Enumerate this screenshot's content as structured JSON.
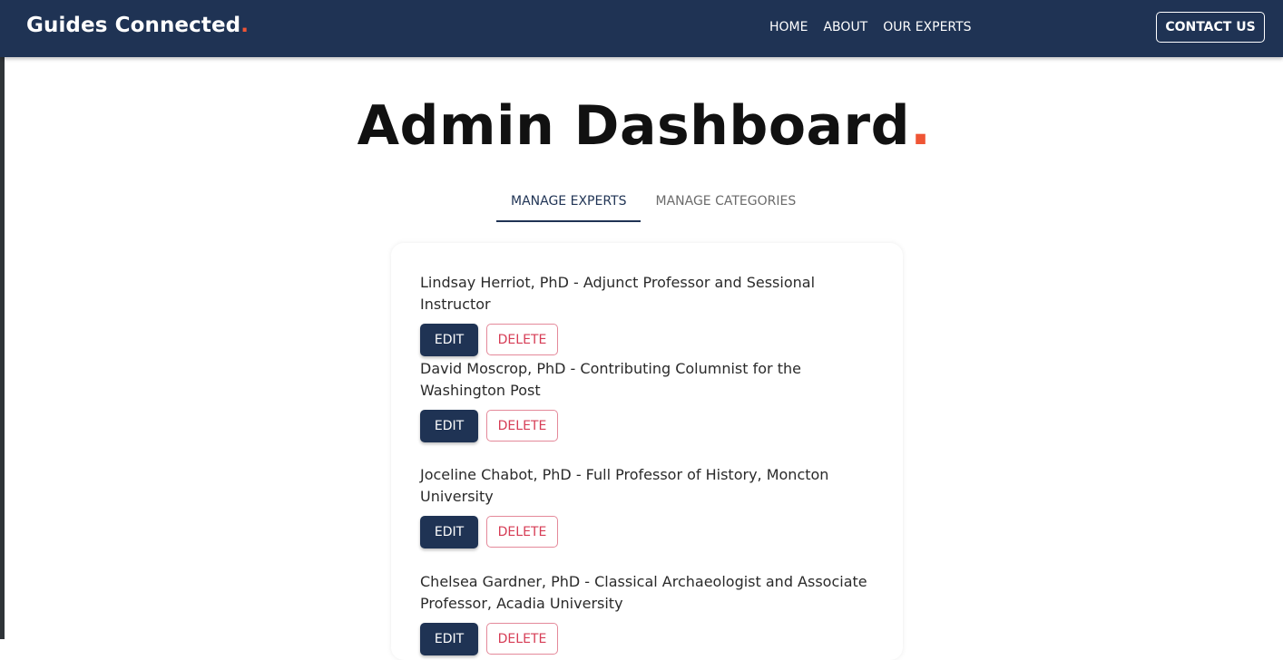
{
  "navbar": {
    "brand": "Guides Connected",
    "brand_dot": ".",
    "links": [
      "HOME",
      "ABOUT",
      "OUR EXPERTS"
    ],
    "contact": "CONTACT US"
  },
  "page": {
    "title": "Admin Dashboard",
    "title_dot": "."
  },
  "tabs": [
    {
      "label": "MANAGE EXPERTS",
      "active": true
    },
    {
      "label": "MANAGE CATEGORIES",
      "active": false
    }
  ],
  "experts": [
    {
      "name": "Lindsay Herriot, PhD - Adjunct Professor and Sessional Instructor"
    },
    {
      "name": "David Moscrop, PhD - Contributing Columnist for the Washington Post"
    },
    {
      "name": "Joceline Chabot, PhD - Full Professor of History, Moncton University"
    },
    {
      "name": "Chelsea Gardner, PhD - Classical Archaeologist and Associate Professor, Acadia University"
    }
  ],
  "actions": {
    "edit": "EDIT",
    "delete": "DELETE"
  },
  "colors": {
    "navy": "#1f3354",
    "accent": "#ef5535",
    "delete_red": "#d63c55"
  }
}
